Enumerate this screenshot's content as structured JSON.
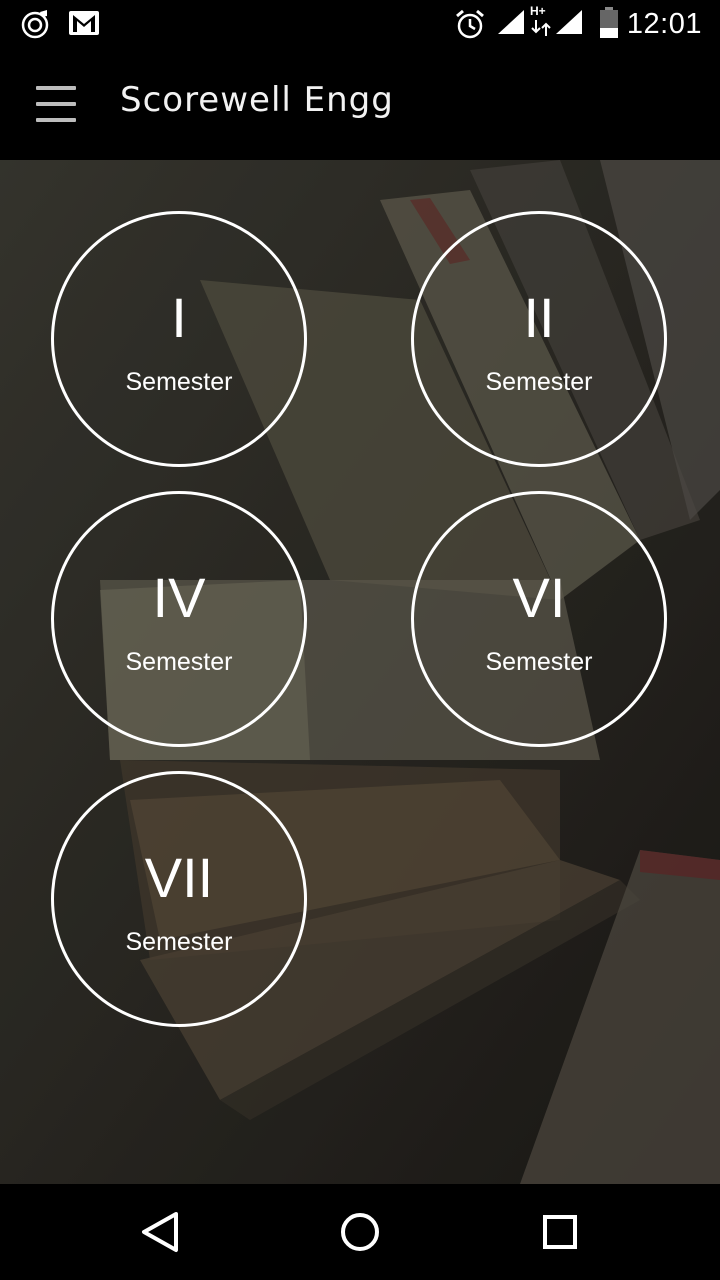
{
  "status_bar": {
    "time": "12:01",
    "icons": [
      "music-icon",
      "gmail-icon",
      "alarm-icon",
      "signal-icon",
      "hplus-data-icon",
      "battery-icon"
    ],
    "network_label": "H+"
  },
  "app_bar": {
    "title": "Scorewell Engg",
    "menu_icon": "hamburger-menu-icon"
  },
  "semesters": [
    {
      "numeral": "I",
      "label": "Semester"
    },
    {
      "numeral": "II",
      "label": "Semester"
    },
    {
      "numeral": "IV",
      "label": "Semester"
    },
    {
      "numeral": "VI",
      "label": "Semester"
    },
    {
      "numeral": "VII",
      "label": "Semester"
    }
  ],
  "nav_bar": {
    "icons": [
      "back-icon",
      "home-icon",
      "recents-icon"
    ]
  },
  "colors": {
    "bars": "#000000",
    "circle_border": "#ffffff",
    "background_tone": "#3b3a33"
  }
}
